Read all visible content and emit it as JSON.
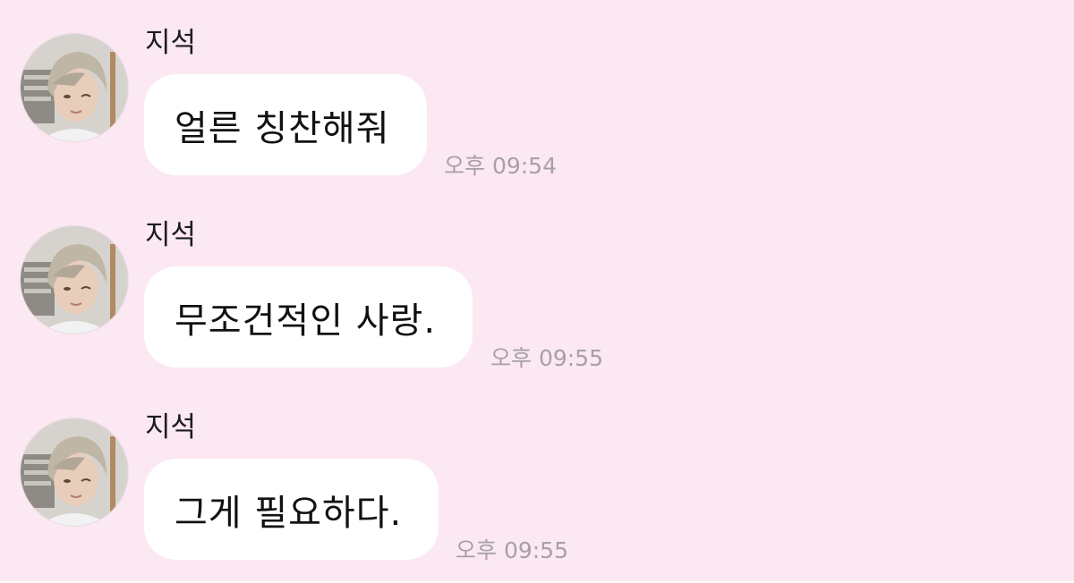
{
  "messages": [
    {
      "sender": "지석",
      "text": "얼른 칭찬해줘",
      "time": "오후 09:54",
      "avatar_icon": "profile-photo-avatar"
    },
    {
      "sender": "지석",
      "text": "무조건적인 사랑.",
      "time": "오후 09:55",
      "avatar_icon": "profile-photo-avatar"
    },
    {
      "sender": "지석",
      "text": "그게 필요하다.",
      "time": "오후 09:55",
      "avatar_icon": "profile-photo-avatar"
    }
  ],
  "colors": {
    "background": "#fbe8f3",
    "bubble": "#ffffff",
    "timestamp": "#a7a0a4",
    "text": "#111111"
  }
}
